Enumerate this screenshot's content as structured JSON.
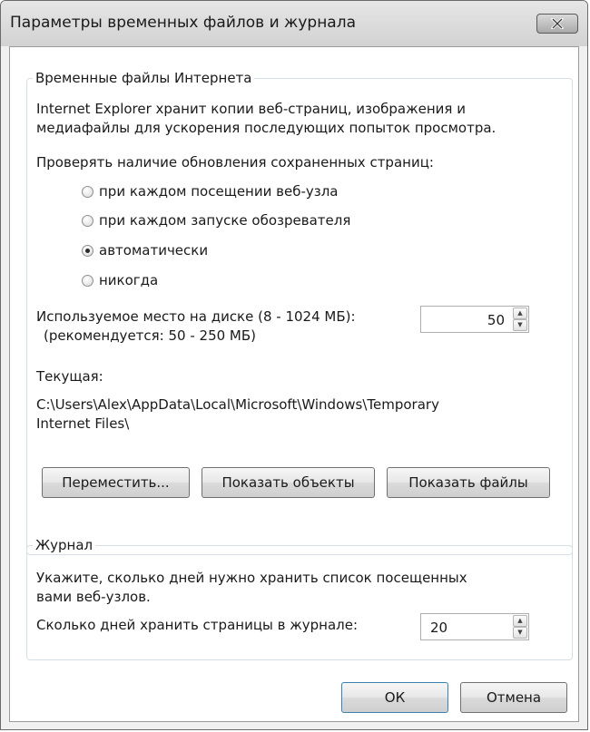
{
  "window": {
    "title": "Параметры временных файлов и журнала",
    "close_symbol": "✕"
  },
  "temp_files": {
    "legend": "Временные файлы Интернета",
    "desc_line1": "Internet Explorer хранит копии веб-страниц, изображения и",
    "desc_line2": "медиафайлы для ускорения последующих попыток просмотра.",
    "check_label": "Проверять наличие обновления сохраненных страниц:",
    "options": [
      {
        "label": "при каждом посещении веб-узла",
        "checked": false
      },
      {
        "label": "при каждом запуске обозревателя",
        "checked": false
      },
      {
        "label": "автоматически",
        "checked": true
      },
      {
        "label": "никогда",
        "checked": false
      }
    ],
    "disk_label_line1": "Используемое место на диске (8 - 1024 МБ):",
    "disk_label_line2": "(рекомендуется: 50 - 250 МБ)",
    "disk_value": "50",
    "current_label": "Текущая:",
    "current_path_line1": "C:\\Users\\Alex\\AppData\\Local\\Microsoft\\Windows\\Temporary",
    "current_path_line2": "Internet Files\\",
    "buttons": {
      "move": "Переместить...",
      "view_objects": "Показать объекты",
      "view_files": "Показать файлы"
    }
  },
  "history": {
    "legend": "Журнал",
    "desc_line1": "Укажите, сколько дней нужно хранить список посещенных",
    "desc_line2": "вами веб-узлов.",
    "days_label": "Сколько дней хранить страницы в журнале:",
    "days_value": "20"
  },
  "footer": {
    "ok": "ОК",
    "cancel": "Отмена"
  },
  "icons": {
    "spin_up": "▲",
    "spin_down": "▼"
  }
}
